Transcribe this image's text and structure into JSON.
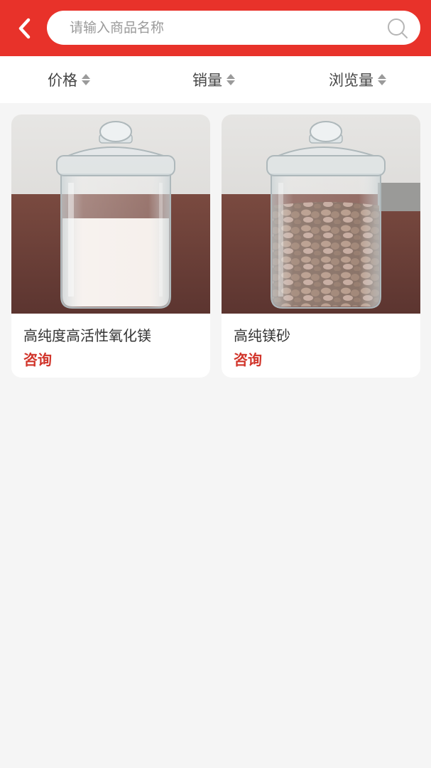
{
  "header": {
    "search_placeholder": "请输入商品名称",
    "icons": {
      "back": "chevron-left-icon",
      "search": "search-icon"
    },
    "colors": {
      "brand": "#e8322a"
    }
  },
  "sort": {
    "items": [
      {
        "label": "价格"
      },
      {
        "label": "销量"
      },
      {
        "label": "浏览量"
      }
    ]
  },
  "products": [
    {
      "title": "高纯度高活性氧化镁",
      "price": "咨询",
      "image": "glass-jar-white-powder"
    },
    {
      "title": "高纯镁砂",
      "price": "咨询",
      "image": "glass-jar-brown-granules"
    }
  ],
  "colors": {
    "price": "#d1352b",
    "background": "#f5f5f5"
  }
}
